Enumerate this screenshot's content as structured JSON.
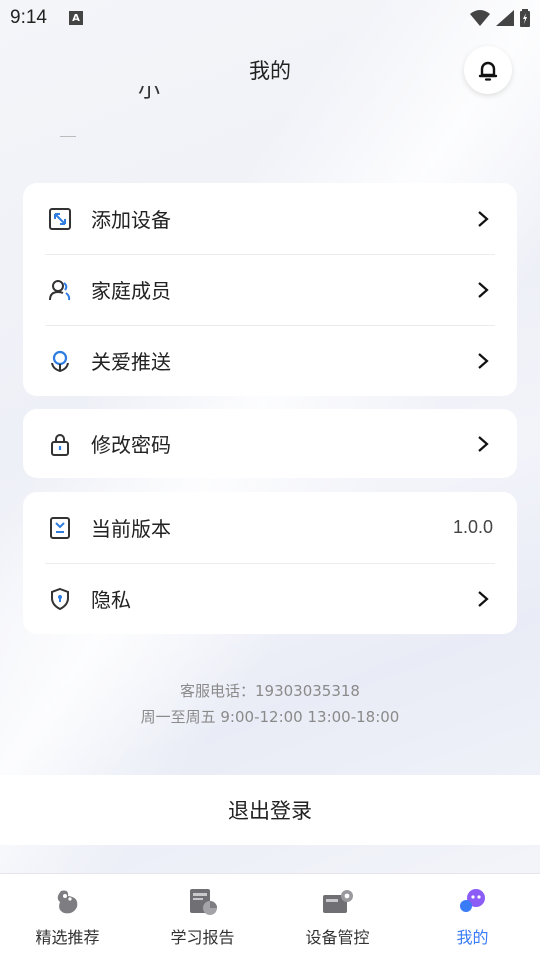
{
  "status_bar": {
    "time": "9:14",
    "notification_icon": "A"
  },
  "header": {
    "title": "我的"
  },
  "profile": {
    "name_fragment": "小"
  },
  "menu_group_1": [
    {
      "label": "添加设备",
      "icon": "add-device-icon"
    },
    {
      "label": "家庭成员",
      "icon": "family-members-icon"
    },
    {
      "label": "关爱推送",
      "icon": "care-push-icon"
    }
  ],
  "menu_group_2": [
    {
      "label": "修改密码",
      "icon": "lock-icon"
    }
  ],
  "menu_group_3": [
    {
      "label": "当前版本",
      "value": "1.0.0",
      "icon": "version-icon"
    },
    {
      "label": "隐私",
      "icon": "privacy-shield-icon"
    }
  ],
  "support": {
    "phone_line": "客服电话：19303035318",
    "hours_line": "周一至周五 9:00-12:00 13:00-18:00"
  },
  "logout": {
    "label": "退出登录"
  },
  "tabbar": [
    {
      "label": "精选推荐"
    },
    {
      "label": "学习报告"
    },
    {
      "label": "设备管控"
    },
    {
      "label": "我的",
      "active": true
    }
  ],
  "colors": {
    "accent": "#3a7bf6",
    "icon_blue": "#2f7de1"
  }
}
